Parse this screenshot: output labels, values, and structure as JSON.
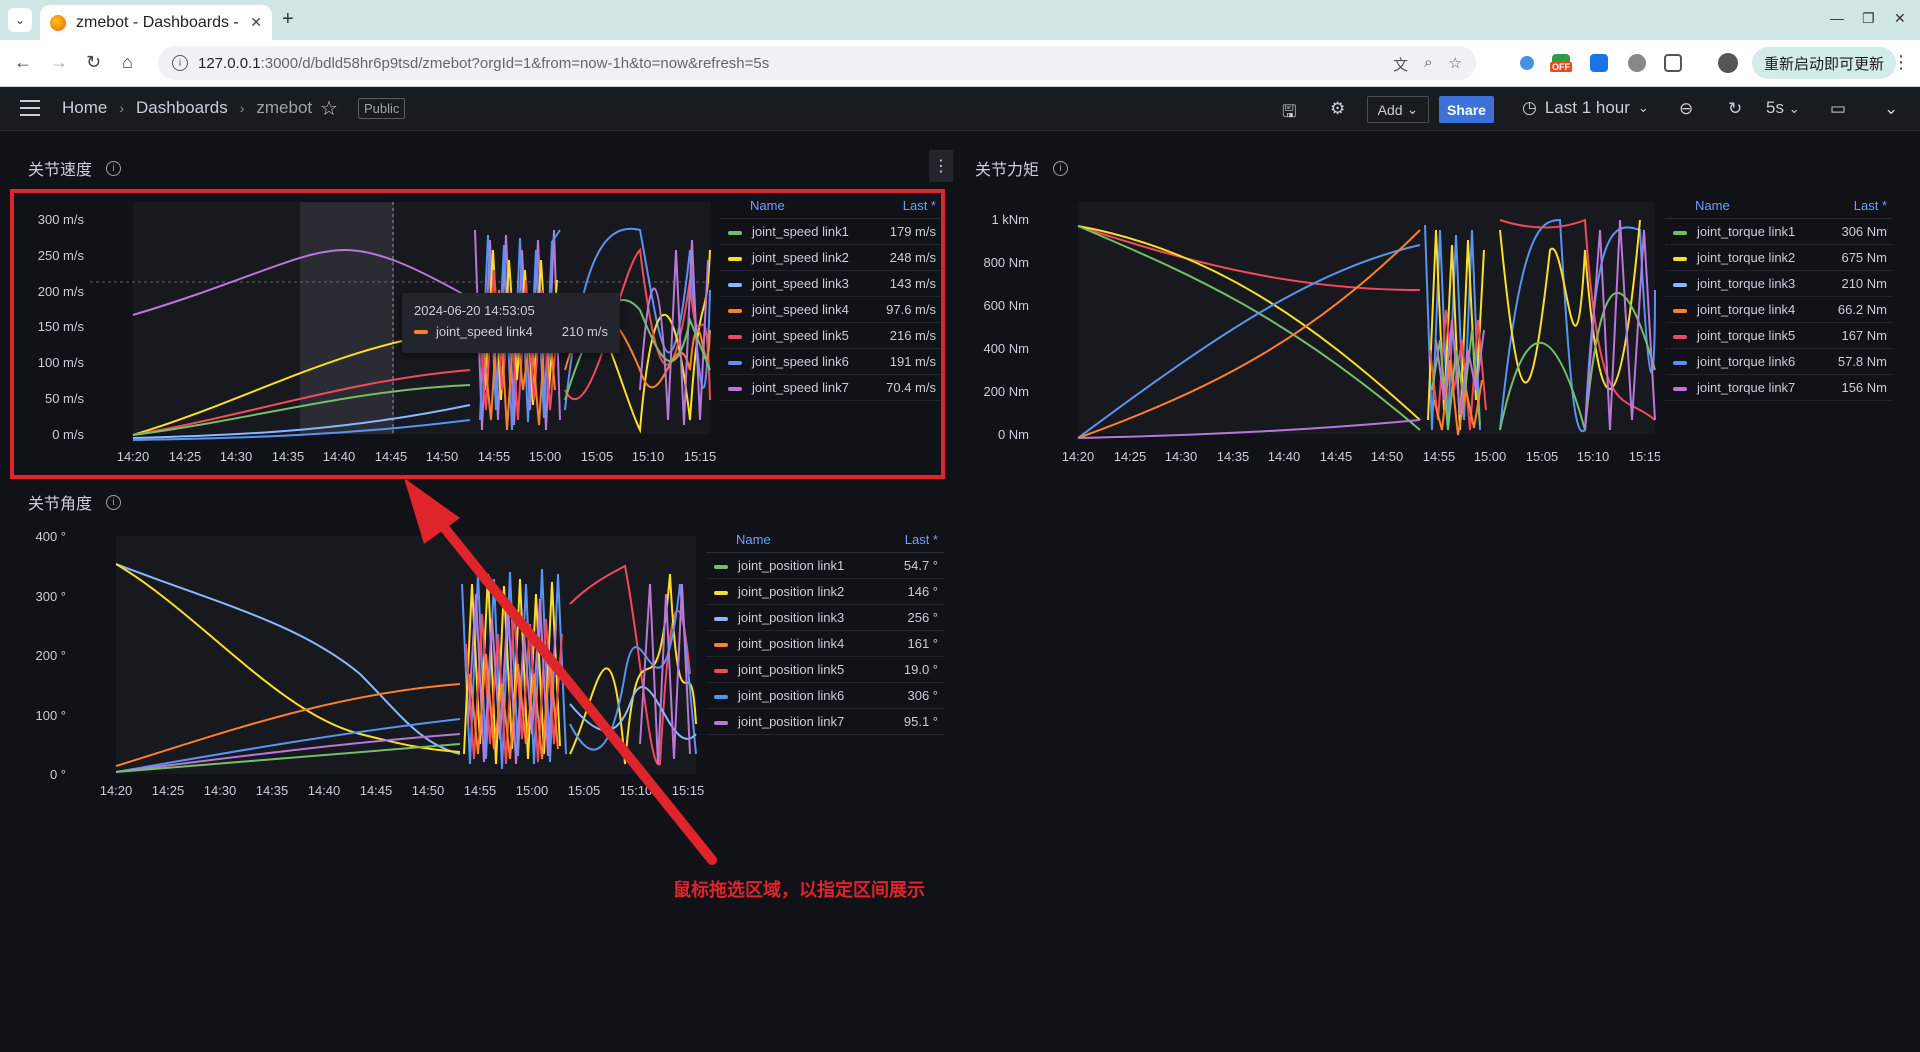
{
  "browser": {
    "tab_title": "zmebot - Dashboards - G",
    "url_host": "127.0.0.1",
    "url_rest": ":3000/d/bdld58hr6p9tsd/zmebot?orgId=1&from=now-1h&to=now&refresh=5s",
    "update_button": "重新启动即可更新",
    "ext_badge": "OFF"
  },
  "nav": {
    "breadcrumbs": [
      "Home",
      "Dashboards",
      "zmebot"
    ],
    "public_label": "Public",
    "add_label": "Add",
    "share_label": "Share",
    "time_range": "Last 1 hour",
    "refresh_interval": "5s"
  },
  "legend_header": {
    "name": "Name",
    "last": "Last *"
  },
  "panels": {
    "speed": {
      "title": "关节速度",
      "y_ticks": [
        "300 m/s",
        "250 m/s",
        "200 m/s",
        "150 m/s",
        "100 m/s",
        "50 m/s",
        "0 m/s"
      ],
      "legend": [
        {
          "name": "joint_speed link1",
          "last": "179 m/s",
          "color": "#73bf69"
        },
        {
          "name": "joint_speed link2",
          "last": "248 m/s",
          "color": "#fade2a"
        },
        {
          "name": "joint_speed link3",
          "last": "143 m/s",
          "color": "#8ab8ff"
        },
        {
          "name": "joint_speed link4",
          "last": "97.6 m/s",
          "color": "#ff7f2a"
        },
        {
          "name": "joint_speed link5",
          "last": "216 m/s",
          "color": "#f2495c"
        },
        {
          "name": "joint_speed link6",
          "last": "191 m/s",
          "color": "#5794f2"
        },
        {
          "name": "joint_speed link7",
          "last": "70.4 m/s",
          "color": "#b877d9"
        }
      ]
    },
    "torque": {
      "title": "关节力矩",
      "y_ticks": [
        "1 kNm",
        "800 Nm",
        "600 Nm",
        "400 Nm",
        "200 Nm",
        "0 Nm"
      ],
      "legend": [
        {
          "name": "joint_torque link1",
          "last": "306 Nm",
          "color": "#73bf69"
        },
        {
          "name": "joint_torque link2",
          "last": "675 Nm",
          "color": "#fade2a"
        },
        {
          "name": "joint_torque link3",
          "last": "210 Nm",
          "color": "#8ab8ff"
        },
        {
          "name": "joint_torque link4",
          "last": "66.2 Nm",
          "color": "#ff7f2a"
        },
        {
          "name": "joint_torque link5",
          "last": "167 Nm",
          "color": "#f2495c"
        },
        {
          "name": "joint_torque link6",
          "last": "57.8 Nm",
          "color": "#5794f2"
        },
        {
          "name": "joint_torque link7",
          "last": "156 Nm",
          "color": "#b877d9"
        }
      ]
    },
    "position": {
      "title": "关节角度",
      "y_ticks": [
        "400 °",
        "300 °",
        "200 °",
        "100 °",
        "0 °"
      ],
      "legend": [
        {
          "name": "joint_position link1",
          "last": "54.7 °",
          "color": "#73bf69"
        },
        {
          "name": "joint_position link2",
          "last": "146 °",
          "color": "#fade2a"
        },
        {
          "name": "joint_position link3",
          "last": "256 °",
          "color": "#8ab8ff"
        },
        {
          "name": "joint_position link4",
          "last": "161 °",
          "color": "#ff7f2a"
        },
        {
          "name": "joint_position link5",
          "last": "19.0 °",
          "color": "#f2495c"
        },
        {
          "name": "joint_position link6",
          "last": "306 °",
          "color": "#5794f2"
        },
        {
          "name": "joint_position link7",
          "last": "95.1 °",
          "color": "#b877d9"
        }
      ]
    }
  },
  "x_ticks": [
    "14:20",
    "14:25",
    "14:30",
    "14:35",
    "14:40",
    "14:45",
    "14:50",
    "14:55",
    "15:00",
    "15:05",
    "15:10",
    "15:15"
  ],
  "tooltip": {
    "time": "2024-06-20 14:53:05",
    "series": "joint_speed link4",
    "value": "210 m/s"
  },
  "annotation_text": "鼠标拖选区域，以指定区间展示"
}
